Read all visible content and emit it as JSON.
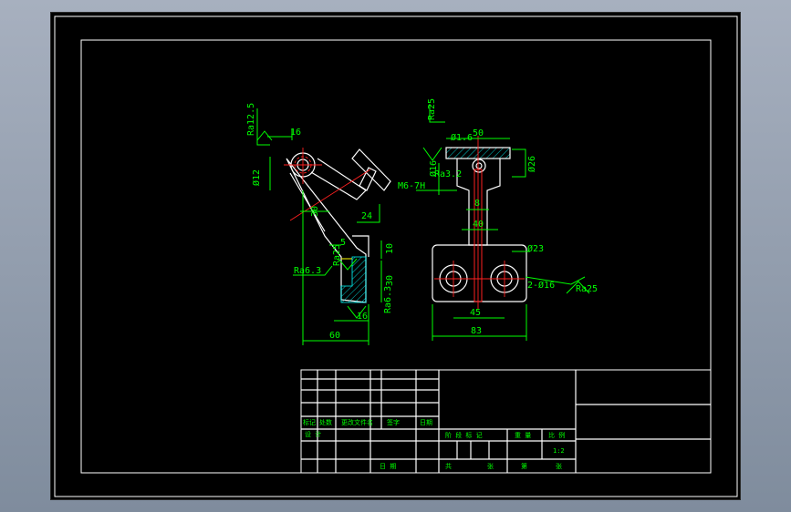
{
  "colors": {
    "background": "#000000",
    "outline": "#ffffff",
    "dimension": "#00ff00",
    "centerline": "#ff2020",
    "hatch": "#00ffff",
    "highlight": "#ffff00"
  },
  "side_view": {
    "roughness_top": "Ra12.5",
    "dim_16_top": "16",
    "dim_phi12": "Ø12",
    "dim_30": "30",
    "dim_24": "24",
    "dim_5": "5",
    "dim_10": "10",
    "dim_30_right": "30",
    "dim_16_bottom": "16",
    "dim_60": "60",
    "roughness_left": "Ra6.3",
    "roughness_mid": "Ra25",
    "roughness_bottom": "Ra6.3"
  },
  "front_view": {
    "roughness_top": "Ra25",
    "dim_m6": "M6-7H",
    "dim_phi16": "Ø16",
    "dim_50": "50",
    "dim_phi16_small": "Ø1.6",
    "dim_phi26": "Ø26",
    "dim_8": "8",
    "dim_40": "40",
    "dim_phi23": "Ø23",
    "dim_2phi16": "2-Ø16",
    "dim_45": "45",
    "dim_83": "83",
    "roughness_right": "Ra25",
    "roughness_left_small": "Ra3.2"
  },
  "title_block": {
    "row_labels": [
      "标记",
      "处数",
      "更改文件名",
      "签字",
      "日期"
    ],
    "design_label": "设 计",
    "stage_labels": [
      "阶 段 标 记",
      "重 量",
      "比 例"
    ],
    "scale_value": "1:2",
    "date_label": "日 期",
    "sheet_labels": [
      "共",
      "张",
      "第",
      "张"
    ]
  }
}
